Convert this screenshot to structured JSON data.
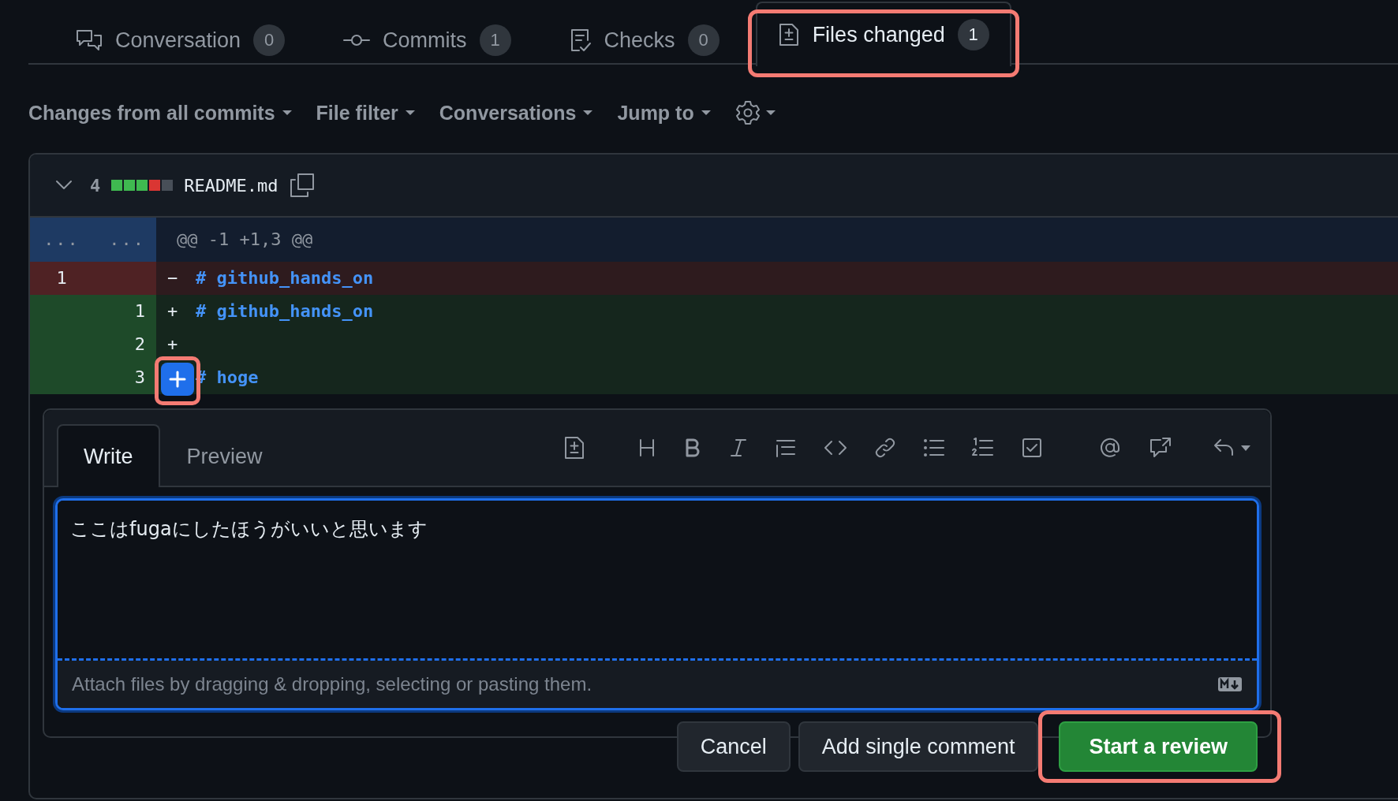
{
  "tabs": [
    {
      "label": "Conversation",
      "count": "0",
      "selected": false,
      "highlighted": false
    },
    {
      "label": "Commits",
      "count": "1",
      "selected": false,
      "highlighted": false
    },
    {
      "label": "Checks",
      "count": "0",
      "selected": false,
      "highlighted": false
    },
    {
      "label": "Files changed",
      "count": "1",
      "selected": true,
      "highlighted": true
    }
  ],
  "toolbar": [
    {
      "kind": "menu",
      "label": "Changes from **all commits**"
    },
    {
      "kind": "menu",
      "label": "File filter"
    },
    {
      "kind": "menu",
      "label": "Conversations"
    },
    {
      "kind": "menu",
      "label": "Jump to"
    },
    {
      "kind": "settings"
    }
  ],
  "file": {
    "expanded": true,
    "changes": "4",
    "diffstat": [
      {
        "color": "#3fb950"
      },
      {
        "color": "#3fb950"
      },
      {
        "color": "#3fb950"
      },
      {
        "color": "#da3633"
      },
      {
        "color": "#484f58"
      }
    ],
    "name": "README.md",
    "hunk": {
      "old": "...",
      "new": "...",
      "text": "@@ -1 +1,3 @@"
    },
    "lines": [
      {
        "kind": "deleted",
        "old": "1",
        "sign": "−",
        "code": "# github_hands_on"
      },
      {
        "kind": "added",
        "new": "1",
        "sign": "+",
        "code": "# github_hands_on"
      },
      {
        "kind": "added",
        "new": "2",
        "sign": "+"
      },
      {
        "kind": "added",
        "new": "3",
        "code": "# hoge",
        "comment_button": true,
        "highlighted": true
      }
    ]
  },
  "comment_form": {
    "tabs": [
      {
        "label": "Write",
        "selected": true
      },
      {
        "label": "Preview",
        "selected": false
      }
    ],
    "value": "ここはfugaにしたほうがいいと思います",
    "footer": "Attach files by dragging & dropping, selecting or pasting them.",
    "buttons": [
      {
        "label": "Cancel",
        "kind": "secondary",
        "highlighted": false
      },
      {
        "label": "Add single comment",
        "kind": "secondary",
        "highlighted": false
      },
      {
        "label": "Start a review",
        "kind": "primary",
        "highlighted": true
      }
    ]
  }
}
